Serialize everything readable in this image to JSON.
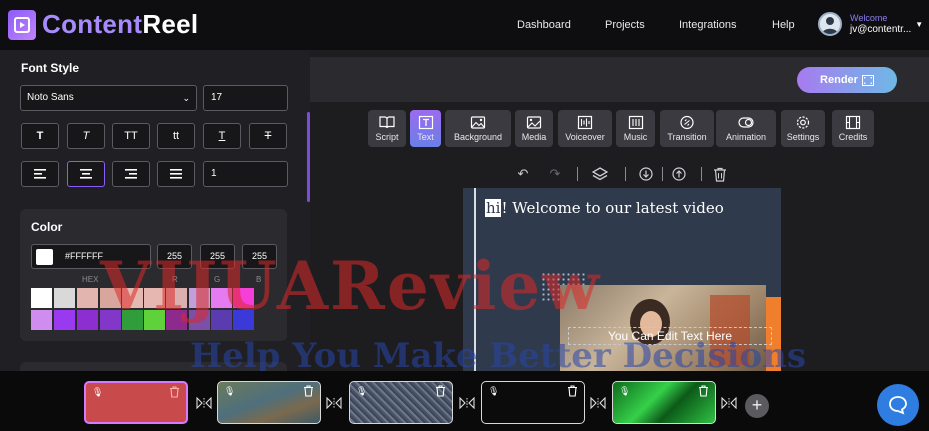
{
  "header": {
    "logo_part1": "Content",
    "logo_part2": "Reel",
    "nav": [
      "Dashboard",
      "Projects",
      "Integrations",
      "Help"
    ],
    "welcome": "Welcome",
    "email": "jv@contentr..."
  },
  "left_panel": {
    "font_style_title": "Font Style",
    "font_family": "Noto Sans",
    "font_size": "17",
    "text_style_buttons": [
      "T",
      "T",
      "TT",
      "tt",
      "T",
      "T"
    ],
    "line_spacing": "1",
    "color_title": "Color",
    "hex_value": "#FFFFFF",
    "r": "255",
    "g": "255",
    "b": "255",
    "labels": {
      "hex": "HEX",
      "r": "R",
      "g": "G",
      "b": "B"
    },
    "swatches_row1": [
      "#ffffff",
      "#d9d9d9",
      "#e2b6ae",
      "#d8a69c",
      "#e3b9b1",
      "#e6b6b0",
      "#dcb0b0",
      "#c29fd8",
      "#e57bf0",
      "#f53fd8"
    ],
    "swatches_row2": [
      "#d08df0",
      "#9a3af0",
      "#8d2fd0",
      "#8237c8",
      "#2f9d3a",
      "#5fd13a",
      "#8e2a8c",
      "#7c50a8",
      "#5a3bb0",
      "#3b3ad8"
    ]
  },
  "render": {
    "label": "Render"
  },
  "toolbar": [
    {
      "label": "Script",
      "icon": "book-icon"
    },
    {
      "label": "Text",
      "icon": "text-icon",
      "active": true
    },
    {
      "label": "Background",
      "icon": "image-icon"
    },
    {
      "label": "Media",
      "icon": "media-icon"
    },
    {
      "label": "Voiceover",
      "icon": "voiceover-icon"
    },
    {
      "label": "Music",
      "icon": "music-icon"
    },
    {
      "label": "Transition",
      "icon": "link-icon"
    },
    {
      "label": "Animation",
      "icon": "toggle-icon"
    },
    {
      "label": "Settings",
      "icon": "gear-icon"
    },
    {
      "label": "Credits",
      "icon": "film-icon"
    }
  ],
  "canvas": {
    "headline_highlight": "hi",
    "headline_rest": "! Welcome to our latest video",
    "edit_text": "You Can Edit Text Here"
  },
  "timeline": {
    "clips": [
      {
        "color": "#c84a4a"
      },
      {
        "color": "#5b6e62"
      },
      {
        "color": "#5a6578"
      },
      {
        "color": "#0b0b0b"
      },
      {
        "color": "#1f8d2c"
      }
    ],
    "add_label": "+"
  },
  "watermark": {
    "line1": "VIJUAReview",
    "line2": "Help You Make Better Decisions"
  }
}
